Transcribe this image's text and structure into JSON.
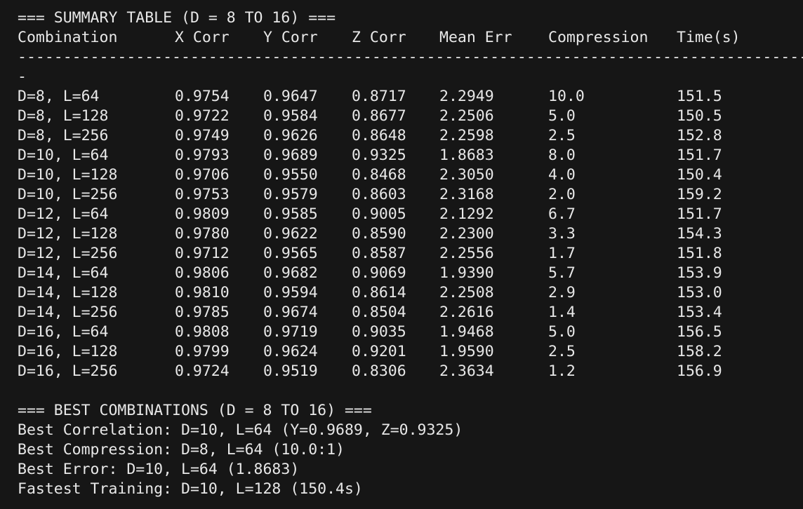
{
  "summary": {
    "title": "=== SUMMARY TABLE (D = 8 TO 16) ===",
    "headers": [
      "Combination",
      "X Corr",
      "Y Corr",
      "Z Corr",
      "Mean Err",
      "Compression",
      "Time(s)"
    ],
    "rule": "-------------------------------------------------------------------------------------------------------",
    "rule_tail": "-",
    "rows": [
      [
        "D=8, L=64",
        "0.9754",
        "0.9647",
        "0.8717",
        "2.2949",
        "10.0",
        "151.5"
      ],
      [
        "D=8, L=128",
        "0.9722",
        "0.9584",
        "0.8677",
        "2.2506",
        "5.0",
        "150.5"
      ],
      [
        "D=8, L=256",
        "0.9749",
        "0.9626",
        "0.8648",
        "2.2598",
        "2.5",
        "152.8"
      ],
      [
        "D=10, L=64",
        "0.9793",
        "0.9689",
        "0.9325",
        "1.8683",
        "8.0",
        "151.7"
      ],
      [
        "D=10, L=128",
        "0.9706",
        "0.9550",
        "0.8468",
        "2.3050",
        "4.0",
        "150.4"
      ],
      [
        "D=10, L=256",
        "0.9753",
        "0.9579",
        "0.8603",
        "2.3168",
        "2.0",
        "159.2"
      ],
      [
        "D=12, L=64",
        "0.9809",
        "0.9585",
        "0.9005",
        "2.1292",
        "6.7",
        "151.7"
      ],
      [
        "D=12, L=128",
        "0.9780",
        "0.9622",
        "0.8590",
        "2.2300",
        "3.3",
        "154.3"
      ],
      [
        "D=12, L=256",
        "0.9712",
        "0.9565",
        "0.8587",
        "2.2556",
        "1.7",
        "151.8"
      ],
      [
        "D=14, L=64",
        "0.9806",
        "0.9682",
        "0.9069",
        "1.9390",
        "5.7",
        "153.9"
      ],
      [
        "D=14, L=128",
        "0.9810",
        "0.9594",
        "0.8614",
        "2.2508",
        "2.9",
        "153.0"
      ],
      [
        "D=14, L=256",
        "0.9785",
        "0.9674",
        "0.8504",
        "2.2616",
        "1.4",
        "153.4"
      ],
      [
        "D=16, L=64",
        "0.9808",
        "0.9719",
        "0.9035",
        "1.9468",
        "5.0",
        "156.5"
      ],
      [
        "D=16, L=128",
        "0.9799",
        "0.9624",
        "0.9201",
        "1.9590",
        "2.5",
        "158.2"
      ],
      [
        "D=16, L=256",
        "0.9724",
        "0.9519",
        "0.8306",
        "2.3634",
        "1.2",
        "156.9"
      ]
    ]
  },
  "best": {
    "title": "=== BEST COMBINATIONS (D = 8 TO 16) ===",
    "lines": [
      "Best Correlation: D=10, L=64 (Y=0.9689, Z=0.9325)",
      "Best Compression: D=8, L=64 (10.0:1)",
      "Best Error: D=10, L=64 (1.8683)",
      "Fastest Training: D=10, L=128 (150.4s)"
    ]
  },
  "colors": {
    "background": "#161616",
    "text": "#e8e8e8"
  }
}
